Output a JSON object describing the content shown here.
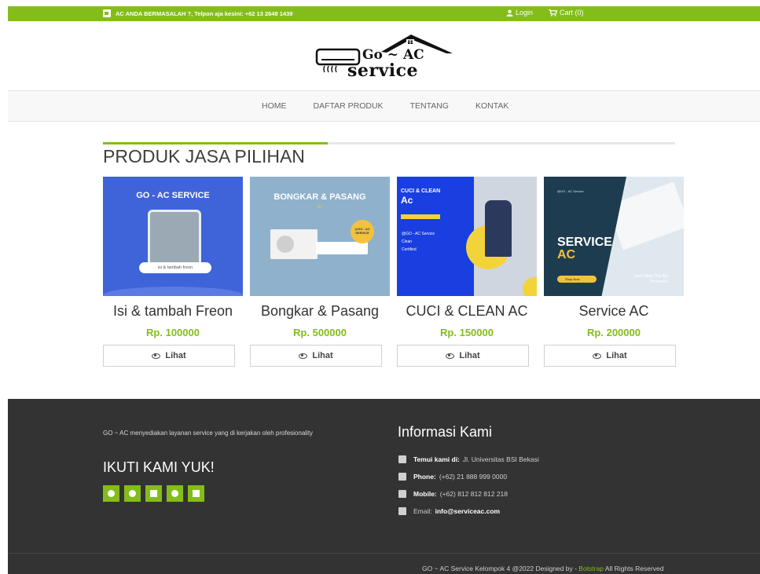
{
  "topbar": {
    "notice": "AC ANDA BERMASALAH ?, Telpon aja kesini: +62 13 2648 1439",
    "login": "Login",
    "cart": "Cart (0)"
  },
  "logo": {
    "line1": "Go ~ AC",
    "line2": "service"
  },
  "nav": [
    "HOME",
    "DAFTAR PRODUK",
    "TENTANG",
    "KONTAK"
  ],
  "section_title": "PRODUK JASA PILIHAN",
  "products": [
    {
      "name": "Isi & tambah Freon",
      "price": "Rp. 100000",
      "button": "Lihat",
      "image": {
        "title": "GO - AC SERVICE",
        "caption": "isi & tambah freon"
      }
    },
    {
      "name": "Bongkar & Pasang",
      "price": "Rp. 500000",
      "button": "Lihat",
      "image": {
        "title": "BONGKAR & PASANG",
        "sub": "AC",
        "badge": "@GO - AC SERVICE"
      }
    },
    {
      "name": "CUCI & CLEAN AC",
      "price": "Rp. 150000",
      "button": "Lihat",
      "image": {
        "title1": "CUCI & CLEAN",
        "title2": "Ac",
        "list": [
          "@GO - AC Service",
          "Clean",
          "Certified"
        ]
      }
    },
    {
      "name": "Service AC",
      "price": "Rp. 200000",
      "button": "Lihat",
      "image": {
        "tiny": "@GO - AC Service",
        "title1": "SERVICE",
        "title2": "AC",
        "shop": "Shop Now",
        "promo": "Don't Miss This Big Promotion"
      }
    }
  ],
  "footer": {
    "about": "GO ~ AC menyediakan layanan service yang di kerjakan oleh profesionality",
    "follow_title": "IKUTI KAMI YUK!",
    "social_icons": [
      "facebook-icon",
      "google-icon",
      "twitter-icon",
      "pinterest-icon",
      "linkedin-icon"
    ],
    "info_title": "Informasi Kami",
    "info": {
      "address_label": "Temui kami di:",
      "address": "Jl. Universitas BSI Bekasi",
      "phone_label": "Phone:",
      "phone": "(+62) 21 888 999 0000",
      "mobile_label": "Mobile:",
      "mobile": "(+62) 812 812 812 218",
      "email_label": "Email:",
      "email": "info@serviceac.com"
    },
    "copyright_prefix": "GO ~ AC Service Kelompok 4 @2022 Designed by -",
    "copyright_link": "Botstrap",
    "copyright_suffix": "All Rights Reserved"
  },
  "colors": {
    "accent": "#84bd1a",
    "footer_bg": "#333333",
    "nav_bg": "#f8f8f8"
  }
}
